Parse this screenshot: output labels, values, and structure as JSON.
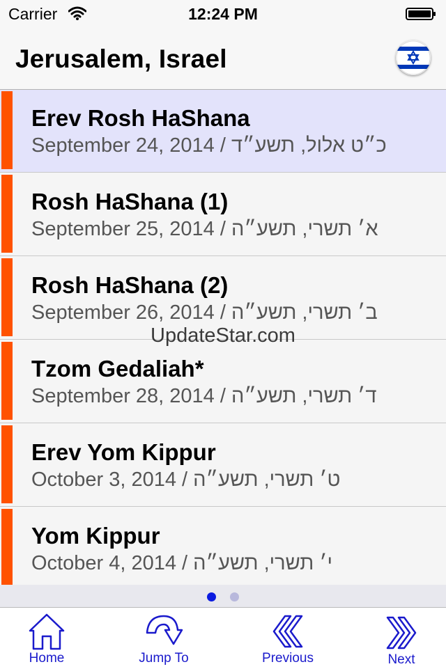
{
  "status_bar": {
    "carrier": "Carrier",
    "time": "12:24 PM"
  },
  "header": {
    "title": "Jerusalem, Israel",
    "flag_icon": "israel-flag-icon"
  },
  "colors": {
    "accent": "#ff5200",
    "selected_row_bg": "#e3e3fb",
    "row_bg": "#f5f5f5",
    "date_text": "#555555",
    "toolbar_blue": "#1a1acc",
    "page_dot_active": "#0b1be0",
    "page_dot_inactive": "#b8b8dc",
    "flag_blue": "#0038b8"
  },
  "holidays": [
    {
      "name": "Erev Rosh HaShana",
      "date": "September 24, 2014 / כ״ט אלול, תשע״ד",
      "selected": true
    },
    {
      "name": "Rosh HaShana (1)",
      "date": "September 25, 2014 / א׳ תשרי, תשע״ה",
      "selected": false
    },
    {
      "name": "Rosh HaShana (2)",
      "date": "September 26, 2014 / ב׳ תשרי, תשע״ה",
      "selected": false
    },
    {
      "name": "Tzom Gedaliah*",
      "date": "September 28, 2014 / ד׳ תשרי, תשע״ה",
      "selected": false
    },
    {
      "name": "Erev Yom Kippur",
      "date": "October 3, 2014 / ט׳ תשרי, תשע״ה",
      "selected": false
    },
    {
      "name": "Yom Kippur",
      "date": "October 4, 2014 / י׳ תשרי, תשע״ה",
      "selected": false
    }
  ],
  "page_indicator": {
    "pages": 2,
    "current": 1
  },
  "watermark": "UpdateStar.com",
  "toolbar": {
    "home_label": "Home",
    "jump_label": "Jump To",
    "previous_label": "Previous",
    "next_label": "Next"
  }
}
